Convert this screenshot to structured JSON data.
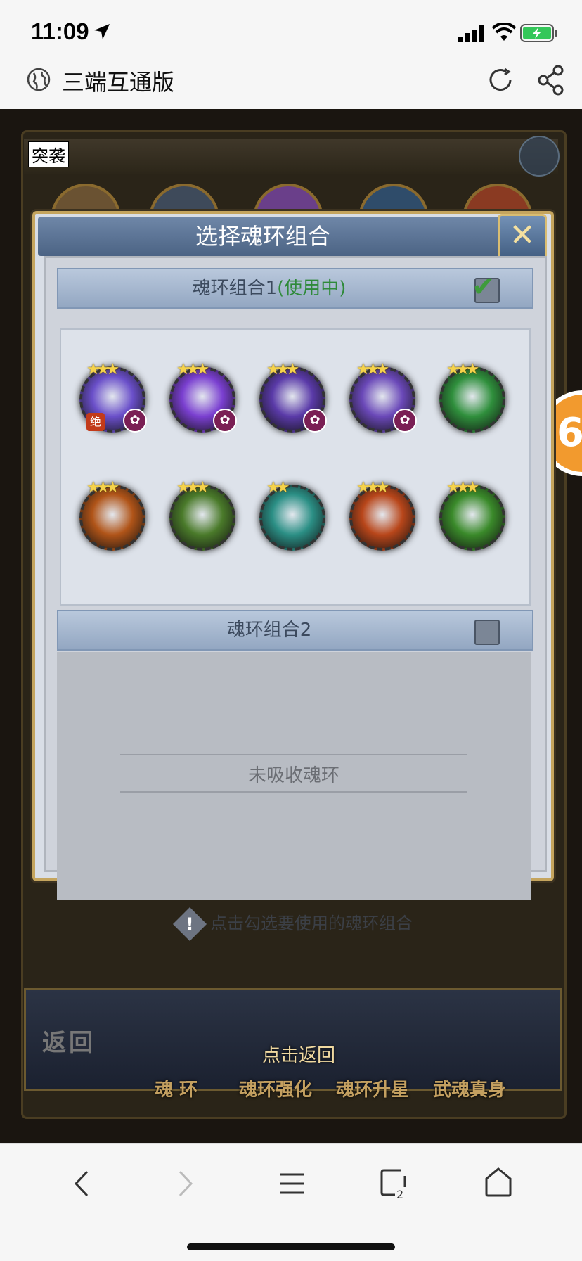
{
  "status": {
    "time": "11:09"
  },
  "browser": {
    "title": "三端互通版"
  },
  "game": {
    "bg_tag": "突袭",
    "side_badge": "6",
    "back_label": "返回",
    "return_hint": "点击返回",
    "tabs": [
      "魂 环",
      "魂环强化",
      "魂环升星",
      "武魂真身"
    ]
  },
  "modal": {
    "title": "选择魂环组合",
    "close_label": "✕",
    "group1": {
      "label": "魂环组合1",
      "status": "(使用中)",
      "checked": true
    },
    "group2": {
      "label": "魂环组合2",
      "checked": false
    },
    "empty_text": "未吸收魂环",
    "hint": "点击勾选要使用的魂环组合",
    "rings": [
      {
        "stars": "★★★",
        "color": "#6a4fc9",
        "badge_flower": "✿",
        "badge_jue": "绝"
      },
      {
        "stars": "★★★",
        "color": "#7a3fd0",
        "badge_flower": "✿"
      },
      {
        "stars": "★★★",
        "color": "#5a3aa8",
        "badge_flower": "✿"
      },
      {
        "stars": "★★★",
        "color": "#6a48b8",
        "badge_flower": "✿"
      },
      {
        "stars": "★★★",
        "color": "#2f8f3c"
      },
      {
        "stars": "★★★",
        "color": "#b05418"
      },
      {
        "stars": "★★★",
        "color": "#4a7a2a"
      },
      {
        "stars": "★★",
        "color": "#2b8f85"
      },
      {
        "stars": "★★★",
        "color": "#b8461a"
      },
      {
        "stars": "★★★",
        "color": "#3a8a2a"
      }
    ]
  }
}
